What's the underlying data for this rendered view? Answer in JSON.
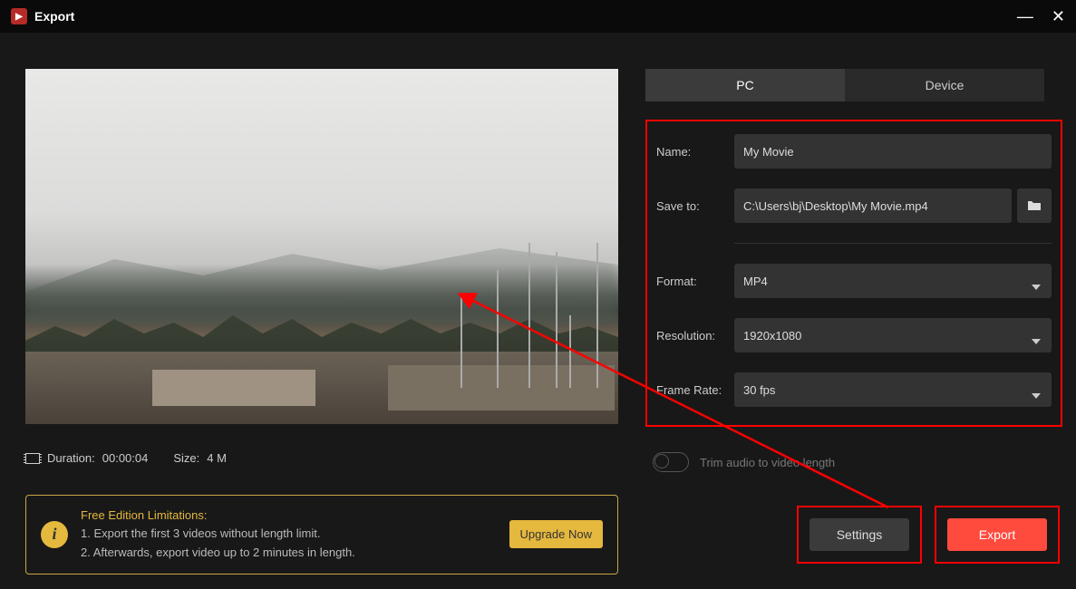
{
  "window": {
    "title": "Export"
  },
  "preview": {
    "duration_label": "Duration:",
    "duration_value": "00:00:04",
    "size_label": "Size:",
    "size_value": "4 M"
  },
  "tabs": {
    "pc": "PC",
    "device": "Device"
  },
  "form": {
    "name_label": "Name:",
    "name_value": "My Movie",
    "save_label": "Save to:",
    "save_value": "C:\\Users\\bj\\Desktop\\My Movie.mp4",
    "format_label": "Format:",
    "format_value": "MP4",
    "resolution_label": "Resolution:",
    "resolution_value": "1920x1080",
    "framerate_label": "Frame Rate:",
    "framerate_value": "30 fps"
  },
  "trim": {
    "label": "Trim audio to video length"
  },
  "limitation": {
    "title": "Free Edition Limitations:",
    "line1": "1. Export the first 3 videos without length limit.",
    "line2": "2. Afterwards, export video up to 2 minutes in length.",
    "upgrade": "Upgrade Now"
  },
  "actions": {
    "settings": "Settings",
    "export": "Export"
  }
}
